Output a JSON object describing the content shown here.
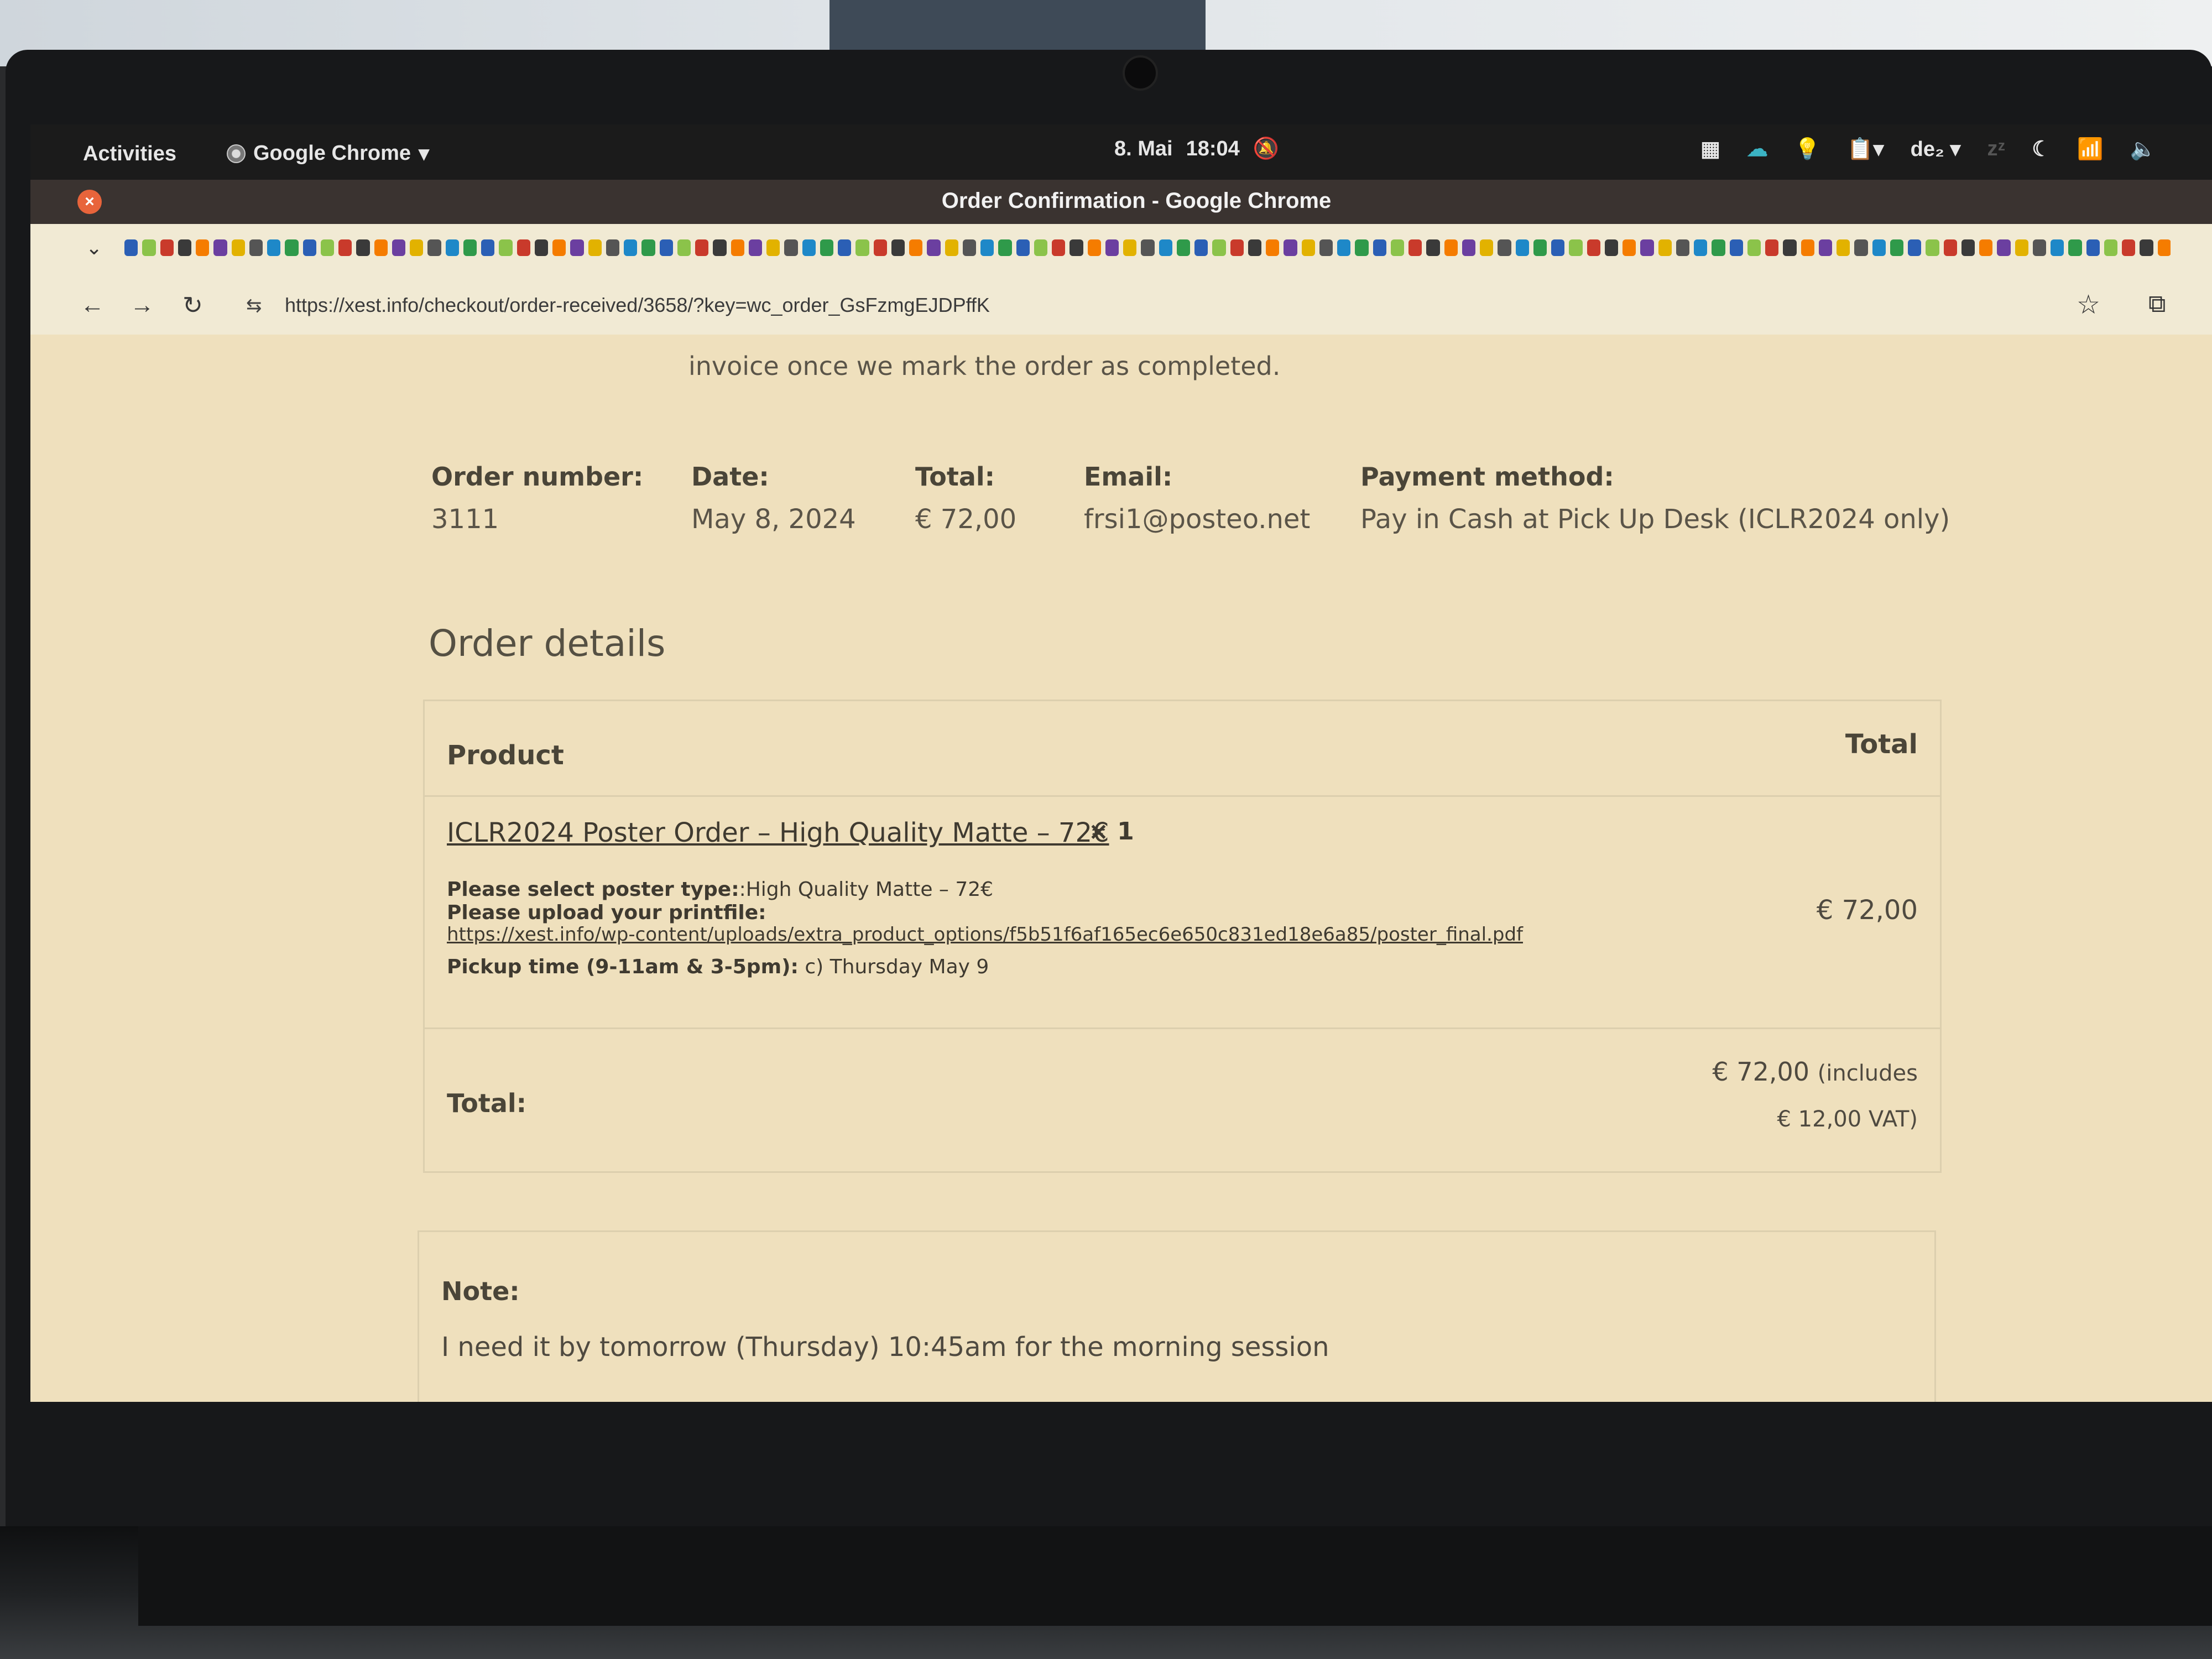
{
  "system_bar": {
    "activities": "Activities",
    "app_name": "Google Chrome",
    "app_menu_icon": "chevron-down-icon",
    "date": "8. Mai",
    "time": "18:04",
    "notifications_muted_icon": "bell-off-icon",
    "input_source": "de₂",
    "tray_icons": [
      "window-list-icon",
      "cloud-icon",
      "lightbulb-icon",
      "clipboard-icon",
      "night-light-icon",
      "wifi-icon",
      "volume-icon"
    ]
  },
  "window": {
    "title": "Order Confirmation - Google Chrome",
    "close_icon": "close-icon"
  },
  "browser": {
    "url": "https://xest.info/checkout/order-received/3658/?key=wc_order_GsFzmgEJDPffK",
    "bookmark_overflow_icon": "chevron-down-icon"
  },
  "page": {
    "intro_text": "invoice once we mark the order as completed.",
    "overview": [
      {
        "label": "Order number:",
        "value": "3111"
      },
      {
        "label": "Date:",
        "value": "May 8, 2024"
      },
      {
        "label": "Total:",
        "value": "€ 72,00"
      },
      {
        "label": "Email:",
        "value": "frsi1@posteo.net"
      },
      {
        "label": "Payment method:",
        "value": "Pay in Cash at Pick Up Desk (ICLR2024 only)"
      }
    ],
    "order_details_heading": "Order details",
    "table": {
      "col_product": "Product",
      "col_total": "Total",
      "item": {
        "name": "ICLR2024 Poster Order – High Quality Matte – 72€",
        "quantity": "× 1",
        "poster_type_label": "Please select poster type:",
        "poster_type_value": ":High Quality Matte – 72€",
        "upload_label": "Please upload your printfile:",
        "upload_link": "https://xest.info/wp-content/uploads/extra_product_options/f5b51f6af165ec6e650c831ed18e6a85/poster_final.pdf",
        "pickup_label": "Pickup time (9-11am & 3-5pm):",
        "pickup_value": "c) Thursday May 9",
        "line_total": "€ 72,00"
      },
      "total_label": "Total:",
      "total_value": "€ 72,00",
      "total_includes": "(includes",
      "total_vat": "€ 12,00 VAT)"
    },
    "note": {
      "label": "Note:",
      "text": "I need it by tomorrow (Thursday) 10:45am for the morning session"
    }
  }
}
